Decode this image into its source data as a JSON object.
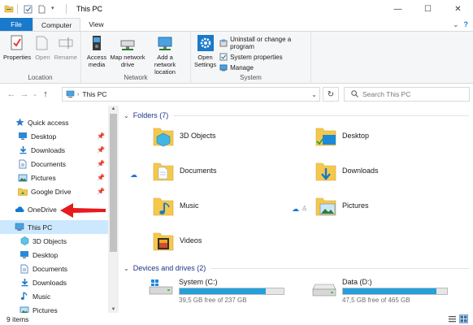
{
  "window": {
    "title": "This PC",
    "controls": {
      "minimize": "—",
      "maximize": "☐",
      "close": "✕"
    }
  },
  "tabs": {
    "file": "File",
    "computer": "Computer",
    "view": "View",
    "collapse": "⌄",
    "help": "?"
  },
  "ribbon": {
    "location": {
      "label": "Location",
      "buttons": [
        "Properties",
        "Open",
        "Rename"
      ]
    },
    "network": {
      "label": "Network",
      "access_media": "Access media",
      "map_network_drive": "Map network drive",
      "add_network_location": "Add a network location"
    },
    "system": {
      "label": "System",
      "open_settings": "Open Settings",
      "items": [
        "Uninstall or change a program",
        "System properties",
        "Manage"
      ]
    }
  },
  "address": {
    "path": "This PC",
    "search_placeholder": "Search This PC"
  },
  "nav": {
    "quick_access": "Quick access",
    "pinned": [
      "Desktop",
      "Downloads",
      "Documents",
      "Pictures"
    ],
    "google_drive": "Google Drive",
    "onedrive": "OneDrive",
    "this_pc": "This PC",
    "this_pc_children": [
      "3D Objects",
      "Desktop",
      "Documents",
      "Downloads",
      "Music",
      "Pictures"
    ]
  },
  "content": {
    "folders_header": "Folders (7)",
    "folders": [
      "3D Objects",
      "Desktop",
      "Documents",
      "Downloads",
      "Music",
      "Pictures",
      "Videos"
    ],
    "drives_header": "Devices and drives (2)",
    "drives": [
      {
        "name": "System (C:)",
        "free": "39,5 GB free of 237 GB",
        "used_fraction": 0.83
      },
      {
        "name": "Data (D:)",
        "free": "47,5 GB free of 465 GB",
        "used_fraction": 0.9
      }
    ]
  },
  "status": {
    "count": "9 items"
  },
  "colors": {
    "accent": "#1979ca",
    "selection": "#cce8ff",
    "drive_fill": "#26a0da",
    "arrow": "#e8191c"
  }
}
